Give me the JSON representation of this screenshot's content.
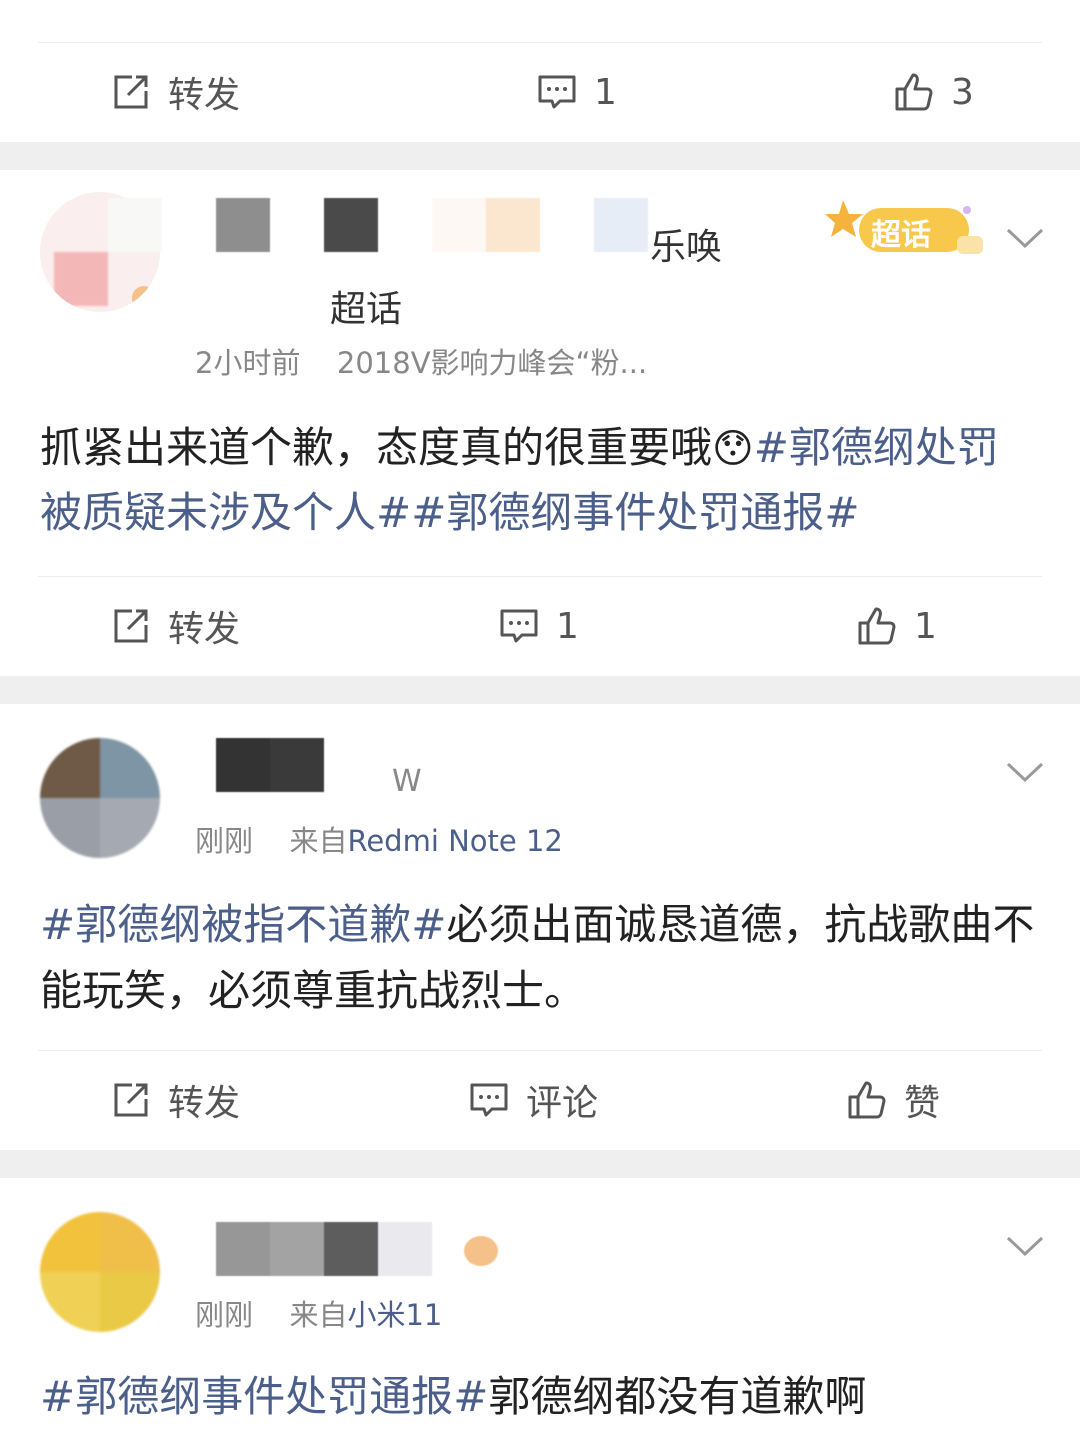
{
  "posts": [
    {
      "actions": {
        "repost": "转发",
        "comment": "1",
        "like": "3"
      }
    },
    {
      "name_suffix": "乐唤",
      "name_line2": "超话",
      "badge": "超话",
      "time": "2小时前",
      "source": "2018V影响力峰会“粉...",
      "text_plain": "抓紧出来道个歉，态度真的很重要哦",
      "emoji": "😯",
      "tags": "#郭德纲处罚被质疑未涉及个人##郭德纲事件处罚通报#",
      "actions": {
        "repost": "转发",
        "comment": "1",
        "like": "1"
      }
    },
    {
      "name_suffix": "W",
      "time": "刚刚",
      "from_label": "来自",
      "source": "Redmi Note 12",
      "tag": "#郭德纲被指不道歉#",
      "text_plain": "必须出面诚恳道德，抗战歌曲不能玩笑，必须尊重抗战烈士。",
      "actions": {
        "repost": "转发",
        "comment": "评论",
        "like": "赞"
      }
    },
    {
      "time": "刚刚",
      "from_label": "来自",
      "source": "小米11",
      "tag": "#郭德纲事件处罚通报#",
      "text_plain": "郭德纲都没有道歉啊"
    }
  ],
  "colors": {
    "link": "#4b5f8a",
    "meta": "#888888",
    "separator": "#efefef"
  },
  "icons": [
    "repost-icon",
    "comment-icon",
    "like-icon",
    "chevron-down-icon",
    "super-topic-badge"
  ]
}
